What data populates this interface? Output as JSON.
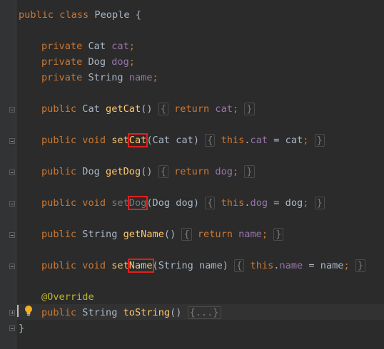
{
  "editor": {
    "lines": {
      "class_decl": {
        "kw1": "public",
        "kw2": "class",
        "name": "People",
        "open": "{"
      },
      "field_cat": {
        "kw": "private",
        "type": "Cat",
        "name": "cat",
        "end": ";"
      },
      "field_dog": {
        "kw": "private",
        "type": "Dog",
        "name": "dog",
        "end": ";"
      },
      "field_name": {
        "kw": "private",
        "type": "String",
        "name": "name",
        "end": ";"
      },
      "get_cat": {
        "kw": "public",
        "type": "Cat",
        "method": "getCat",
        "parens": "()",
        "body_open": "{",
        "ret": "return",
        "field": "cat",
        "end": ";",
        "body_close": "}"
      },
      "set_cat": {
        "kw1": "public",
        "kw2": "void",
        "prefix": "set",
        "highlight": "Cat",
        "params": "(Cat cat)",
        "body_open": "{",
        "this": "this",
        "dot": ".",
        "field": "cat",
        "assign": " = cat",
        "end": ";",
        "body_close": "}"
      },
      "get_dog": {
        "kw": "public",
        "type": "Dog",
        "method": "getDog",
        "parens": "()",
        "body_open": "{",
        "ret": "return",
        "field": "dog",
        "end": ";",
        "body_close": "}"
      },
      "set_dog": {
        "kw1": "public",
        "kw2": "void",
        "prefix": "set",
        "highlight": "Dog",
        "params": "(Dog dog)",
        "body_open": "{",
        "this": "this",
        "dot": ".",
        "field": "dog",
        "assign": " = dog",
        "end": ";",
        "body_close": "}"
      },
      "get_name": {
        "kw": "public",
        "type": "String",
        "method": "getName",
        "parens": "()",
        "body_open": "{",
        "ret": "return",
        "field": "name",
        "end": ";",
        "body_close": "}"
      },
      "set_name": {
        "kw1": "public",
        "kw2": "void",
        "prefix": "set",
        "highlight": "Name",
        "params": "(String name)",
        "body_open": "{",
        "this": "this",
        "dot": ".",
        "field": "name",
        "assign": " = name",
        "end": ";",
        "body_close": "}"
      },
      "override": {
        "annotation": "@Override"
      },
      "to_string": {
        "kw": "public",
        "type": "String",
        "method": "toString",
        "parens": "()",
        "folded": "{...}"
      },
      "class_close": {
        "close": "}"
      }
    }
  },
  "colors": {
    "background": "#2b2b2b",
    "keyword": "#cc7832",
    "field": "#9876aa",
    "method": "#ffc66d",
    "annotation": "#bbb529",
    "text": "#a9b7c6",
    "highlight_box": "#e02020"
  },
  "icons": {
    "intention_bulb": "lightbulb-icon",
    "fold_marker": "fold-marker-icon"
  }
}
